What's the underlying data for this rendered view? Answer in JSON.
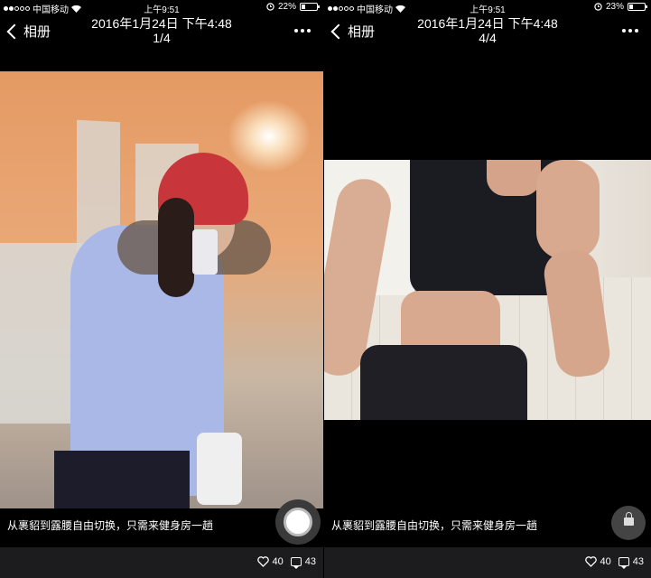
{
  "panels": [
    {
      "status": {
        "carrier": "中国移动",
        "time": "上午9:51",
        "battery": "22%",
        "battery_level": 0.22
      },
      "nav": {
        "back_label": "相册",
        "title_date": "2016年1月24日 下午4:48",
        "title_index": "1/4"
      },
      "caption": "从裹貂到露腰自由切换，只需来健身房一趟",
      "likes": "40",
      "comments": "43"
    },
    {
      "status": {
        "carrier": "中国移动",
        "time": "上午9:51",
        "battery": "23%",
        "battery_level": 0.23
      },
      "nav": {
        "back_label": "相册",
        "title_date": "2016年1月24日 下午4:48",
        "title_index": "4/4"
      },
      "caption": "从裹貂到露腰自由切换，只需来健身房一趟",
      "likes": "40",
      "comments": "43"
    }
  ],
  "colors": {
    "background": "#000000",
    "bottom_bar": "#1c1c1e"
  },
  "icons": [
    "wifi-icon",
    "alarm-icon",
    "battery-icon",
    "chevron-left-icon",
    "more-icon",
    "capture-icon",
    "lock-icon",
    "heart-icon",
    "comment-icon"
  ]
}
